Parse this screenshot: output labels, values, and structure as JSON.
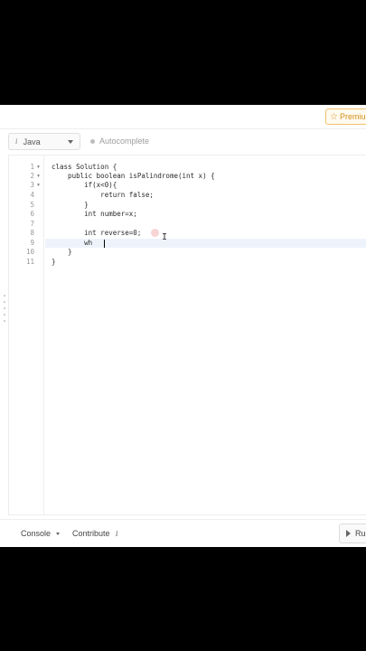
{
  "header": {
    "premium_label": "Premium"
  },
  "toolbar": {
    "language_icon": "i",
    "language": "Java",
    "autocomplete_label": "Autocomplete"
  },
  "editor": {
    "line_numbers": [
      "1",
      "2",
      "3",
      "4",
      "5",
      "6",
      "7",
      "8",
      "9",
      "10",
      "11"
    ],
    "lines": [
      "class Solution {",
      "    public boolean isPalindrome(int x) {",
      "        if(x<0){",
      "            return false;",
      "        }",
      "        int number=x;",
      "",
      "        int reverse=0;",
      "        wh",
      "    }",
      "}"
    ]
  },
  "footer": {
    "console_label": "Console",
    "contribute_label": "Contribute",
    "contribute_icon": "i",
    "run_label": "Ru"
  },
  "colors": {
    "premium": "#d4901a",
    "active_line": "#eef3fb"
  }
}
